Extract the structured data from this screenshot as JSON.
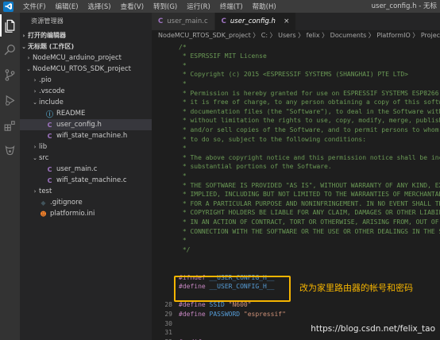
{
  "titlebar": {
    "menu": [
      "文件(F)",
      "编辑(E)",
      "选择(S)",
      "查看(V)",
      "转到(G)",
      "运行(R)",
      "终端(T)",
      "帮助(H)"
    ],
    "window_title": "user_config.h - 无标"
  },
  "activity_icons": [
    "explorer-icon",
    "search-icon",
    "source-control-icon",
    "run-debug-icon",
    "extensions-icon",
    "platformio-icon"
  ],
  "sidebar": {
    "title": "资源管理器",
    "open_editors": "打开的编辑器",
    "workspace": "无标题 (工作区)",
    "tree": [
      {
        "label": "NodeMCU_arduino_project",
        "indent": 1,
        "chev": "›",
        "icon": ""
      },
      {
        "label": "NodeMCU_RTOS_SDK_project",
        "indent": 1,
        "chev": "⌄",
        "icon": ""
      },
      {
        "label": ".pio",
        "indent": 2,
        "chev": "›",
        "icon": ""
      },
      {
        "label": ".vscode",
        "indent": 2,
        "chev": "›",
        "icon": ""
      },
      {
        "label": "include",
        "indent": 2,
        "chev": "⌄",
        "icon": ""
      },
      {
        "label": "README",
        "indent": 3,
        "chev": "",
        "icon": "ⓘ"
      },
      {
        "label": "user_config.h",
        "indent": 3,
        "chev": "",
        "icon": "C",
        "selected": true
      },
      {
        "label": "wifi_state_machine.h",
        "indent": 3,
        "chev": "",
        "icon": "C"
      },
      {
        "label": "lib",
        "indent": 2,
        "chev": "›",
        "icon": ""
      },
      {
        "label": "src",
        "indent": 2,
        "chev": "⌄",
        "icon": ""
      },
      {
        "label": "user_main.c",
        "indent": 3,
        "chev": "",
        "icon": "C"
      },
      {
        "label": "wifi_state_machine.c",
        "indent": 3,
        "chev": "",
        "icon": "C"
      },
      {
        "label": "test",
        "indent": 2,
        "chev": "›",
        "icon": ""
      },
      {
        "label": ".gitignore",
        "indent": 2,
        "chev": "",
        "icon": "◆"
      },
      {
        "label": "platformio.ini",
        "indent": 2,
        "chev": "",
        "icon": "☻"
      }
    ]
  },
  "editor": {
    "tabs": [
      {
        "label": "user_main.c",
        "active": false
      },
      {
        "label": "user_config.h",
        "active": true,
        "close": "×"
      }
    ],
    "breadcrumb": "NodeMCU_RTOS_SDK_project 〉 C: 〉 Users 〉 felix 〉 Documents 〉 PlatformIO 〉 Projects 〉 NodeMCU_",
    "lines": [
      {
        "n": "",
        "t": "/*",
        "c": "cm"
      },
      {
        "n": "",
        "t": " * ESPRSSIF MIT License",
        "c": "cm"
      },
      {
        "n": "",
        "t": " *",
        "c": "cm"
      },
      {
        "n": "",
        "t": " * Copyright (c) 2015 <ESPRESSIF SYSTEMS (SHANGHAI) PTE LTD>",
        "c": "cm"
      },
      {
        "n": "",
        "t": " *",
        "c": "cm"
      },
      {
        "n": "",
        "t": " * Permission is hereby granted for use on ESPRESSIF SYSTEMS ESP8266 only, in which case,",
        "c": "cm"
      },
      {
        "n": "",
        "t": " * it is free of charge, to any person obtaining a copy of this software and associated",
        "c": "cm"
      },
      {
        "n": "",
        "t": " * documentation files (the \"Software\"), to deal in the Software without restriction, including",
        "c": "cm"
      },
      {
        "n": "",
        "t": " * without limitation the rights to use, copy, modify, merge, publish, distribute, sublicense,",
        "c": "cm"
      },
      {
        "n": "",
        "t": " * and/or sell copies of the Software, and to permit persons to whom the Software is furnished",
        "c": "cm"
      },
      {
        "n": "",
        "t": " * to do so, subject to the following conditions:",
        "c": "cm"
      },
      {
        "n": "",
        "t": " *",
        "c": "cm"
      },
      {
        "n": "",
        "t": " * The above copyright notice and this permission notice shall be included in all copies or",
        "c": "cm"
      },
      {
        "n": "",
        "t": " * substantial portions of the Software.",
        "c": "cm"
      },
      {
        "n": "",
        "t": " *",
        "c": "cm"
      },
      {
        "n": "",
        "t": " * THE SOFTWARE IS PROVIDED \"AS IS\", WITHOUT WARRANTY OF ANY KIND, EXPRESS OR",
        "c": "cm"
      },
      {
        "n": "",
        "t": " * IMPLIED, INCLUDING BUT NOT LIMITED TO THE WARRANTIES OF MERCHANTABILITY, FITNESS",
        "c": "cm"
      },
      {
        "n": "",
        "t": " * FOR A PARTICULAR PURPOSE AND NONINFRINGEMENT. IN NO EVENT SHALL THE AUTHORS OR",
        "c": "cm"
      },
      {
        "n": "",
        "t": " * COPYRIGHT HOLDERS BE LIABLE FOR ANY CLAIM, DAMAGES OR OTHER LIABILITY, WHETHER",
        "c": "cm"
      },
      {
        "n": "",
        "t": " * IN AN ACTION OF CONTRACT, TORT OR OTHERWISE, ARISING FROM, OUT OF OR IN",
        "c": "cm"
      },
      {
        "n": "",
        "t": " * CONNECTION WITH THE SOFTWARE OR THE USE OR OTHER DEALINGS IN THE SOFTWARE.",
        "c": "cm"
      },
      {
        "n": "",
        "t": " *",
        "c": "cm"
      },
      {
        "n": "",
        "t": " */",
        "c": "cm"
      },
      {
        "n": "",
        "t": "",
        "c": ""
      },
      {
        "n": "",
        "t": "",
        "c": ""
      },
      {
        "n": "",
        "t": "#ifndef __USER_CONFIG_H__",
        "c": "pp"
      },
      {
        "n": "",
        "t": "#define __USER_CONFIG_H__",
        "c": "pp"
      },
      {
        "n": "",
        "t": "",
        "c": ""
      },
      {
        "n": "28",
        "t": "#define SSID \"N600\"",
        "c": "def"
      },
      {
        "n": "29",
        "t": "#define PASSWORD \"espressif\"",
        "c": "def"
      },
      {
        "n": "30",
        "t": "",
        "c": ""
      },
      {
        "n": "31",
        "t": "",
        "c": ""
      },
      {
        "n": "32",
        "t": "#endif",
        "c": "pp"
      }
    ]
  },
  "annotation": "改为家里路由器的帐号和密码",
  "watermark": "https://blog.csdn.net/felix_tao",
  "colors": {
    "highlight": "#f5b400",
    "comment": "#6a9955",
    "keyword": "#c586c0",
    "macro": "#569cd6",
    "string": "#ce9178"
  }
}
